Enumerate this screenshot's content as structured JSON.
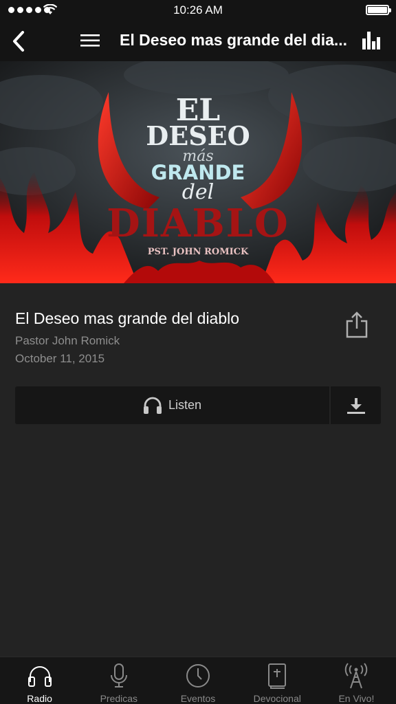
{
  "status_bar": {
    "time": "10:26 AM"
  },
  "nav": {
    "title": "El Deseo mas grande del dia..."
  },
  "artwork": {
    "line1": "EL",
    "line2": "DESEO",
    "line3": "más",
    "line4": "GRANDE",
    "line5": "del",
    "line6": "DIABLO",
    "credit": "PST. JOHN ROMICK"
  },
  "sermon": {
    "title": "El Deseo mas grande del diablo",
    "pastor": "Pastor John Romick",
    "date": "October 11, 2015"
  },
  "actions": {
    "listen_label": "Listen"
  },
  "tabs": [
    {
      "label": "Radio",
      "icon": "headphones-icon",
      "active": true
    },
    {
      "label": "Predicas",
      "icon": "microphone-icon"
    },
    {
      "label": "Eventos",
      "icon": "clock-icon"
    },
    {
      "label": "Devocional",
      "icon": "bible-icon"
    },
    {
      "label": "En Vivo!",
      "icon": "broadcast-tower-icon"
    }
  ],
  "colors": {
    "accent": "#d71c1c",
    "background": "#232323",
    "bar": "#141414"
  }
}
